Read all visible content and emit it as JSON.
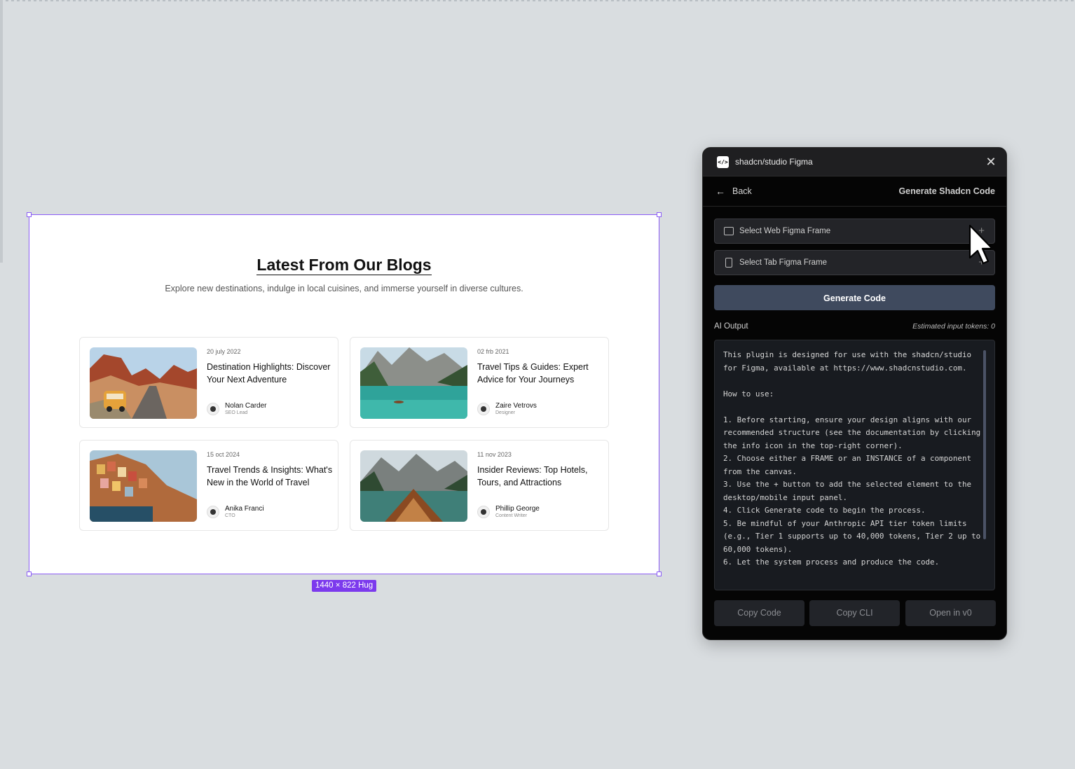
{
  "frame": {
    "title": "Latest From Our Blogs",
    "subtitle": "Explore new destinations, indulge in local cuisines, and immerse yourself in diverse cultures.",
    "size_badge": "1440 × 822 Hug",
    "cards": [
      {
        "date": "20 july 2022",
        "title": "Destination Highlights: Discover Your Next Adventure",
        "author": "Nolan Carder",
        "role": "SEO Lead"
      },
      {
        "date": "02 frb 2021",
        "title": "Travel Tips & Guides: Expert Advice for Your Journeys",
        "author": "Zaire Vetrovs",
        "role": "Designer"
      },
      {
        "date": "15 oct 2024",
        "title": "Travel Trends & Insights: What's New in the World of Travel",
        "author": "Anika Franci",
        "role": "CTO"
      },
      {
        "date": "11 nov 2023",
        "title": "Insider Reviews: Top Hotels, Tours, and Attractions",
        "author": "Phillip George",
        "role": "Content Writer"
      }
    ]
  },
  "plugin": {
    "title": "shadcn/studio Figma",
    "logo": "</>",
    "close": "✕",
    "back_label": "Back",
    "header_right": "Generate Shadcn Code",
    "select_web": "Select Web Figma Frame",
    "select_tab": "Select Tab Figma Frame",
    "plus": "+",
    "generate_label": "Generate Code",
    "ai_output_label": "AI Output",
    "tokens_label": "Estimated input tokens: 0",
    "output_text": "This plugin is designed for use with the shadcn/studio for Figma, available at https://www.shadcnstudio.com.\n\nHow to use:\n\n1. Before starting, ensure your design aligns with our recommended structure (see the documentation by clicking the info icon in the top-right corner).\n2. Choose either a FRAME or an INSTANCE of a component from the canvas.\n3. Use the + button to add the selected element to the desktop/mobile input panel.\n4. Click Generate code to begin the process.\n5. Be mindful of your Anthropic API tier token limits (e.g., Tier 1 supports up to 40,000 tokens, Tier 2 up to 60,000 tokens).\n6. Let the system process and produce the code.",
    "buttons": [
      "Copy Code",
      "Copy CLI",
      "Open in v0"
    ]
  }
}
